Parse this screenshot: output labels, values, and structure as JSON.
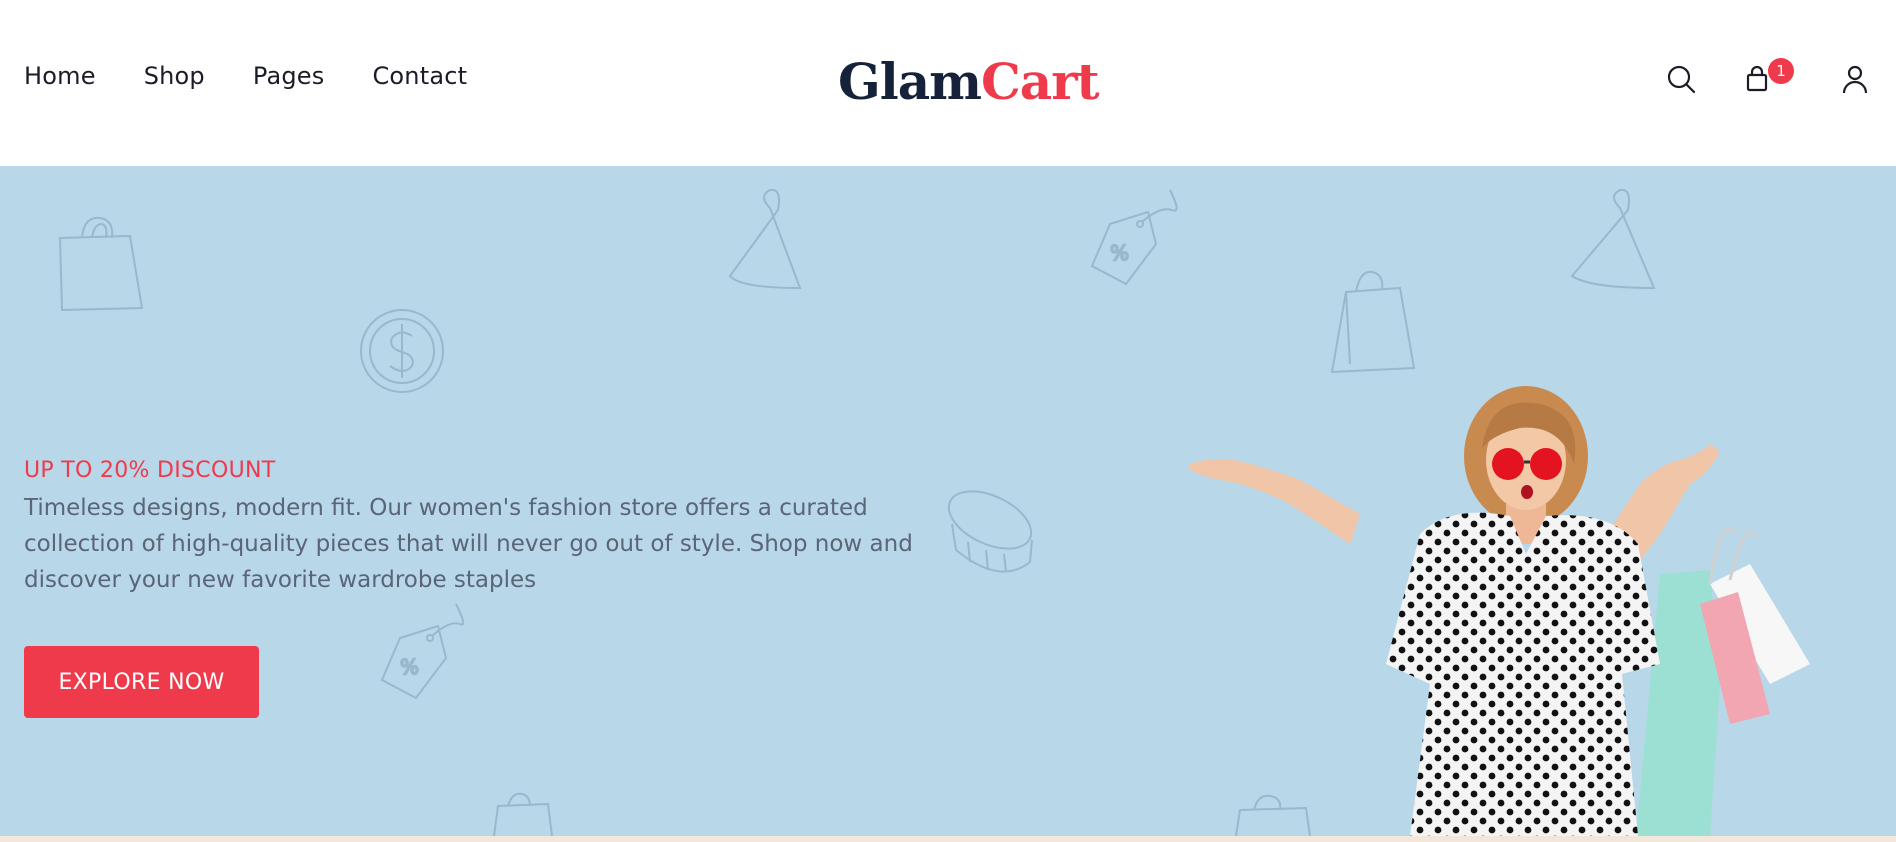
{
  "nav": {
    "items": [
      {
        "label": "Home"
      },
      {
        "label": "Shop"
      },
      {
        "label": "Pages"
      },
      {
        "label": "Contact"
      }
    ]
  },
  "logo": {
    "part1": "Glam",
    "part2": "Cart"
  },
  "header_icons": {
    "search": "search-icon",
    "cart": "shopping-bag-icon",
    "account": "user-icon",
    "cart_count": "1"
  },
  "hero": {
    "eyebrow": "UP TO 20% DISCOUNT",
    "description": "Timeless designs, modern fit. Our women's fashion store offers a curated collection of high-quality pieces that will never go out of style. Shop now and discover your new favorite wardrobe staples",
    "cta_label": "EXPLORE NOW",
    "background_color": "#b8d7e9",
    "accent_color": "#ef3a4c"
  }
}
